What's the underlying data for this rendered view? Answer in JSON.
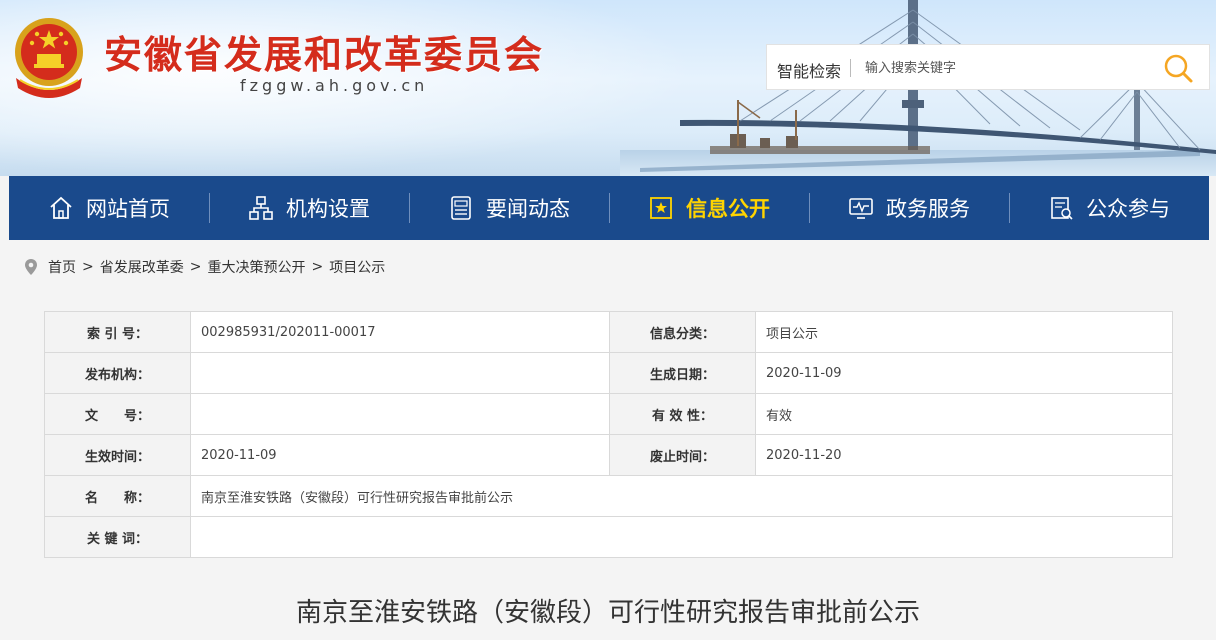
{
  "header": {
    "site_title": "安徽省发展和改革委员会",
    "site_domain": "fzggw.ah.gov.cn",
    "emblem_icon": "national-emblem-icon",
    "title_color": "#d42c1c"
  },
  "search": {
    "label": "智能检索",
    "placeholder": "输入搜索关键字",
    "icon": "search-icon",
    "icon_color": "#f5a623"
  },
  "nav": {
    "background": "#1a4a8c",
    "active_color": "#ffd400",
    "items": [
      {
        "label": "网站首页",
        "icon": "home-icon",
        "active": false
      },
      {
        "label": "机构设置",
        "icon": "org-chart-icon",
        "active": false
      },
      {
        "label": "要闻动态",
        "icon": "news-icon",
        "active": false
      },
      {
        "label": "信息公开",
        "icon": "document-star-icon",
        "active": true
      },
      {
        "label": "政务服务",
        "icon": "monitor-icon",
        "active": false
      },
      {
        "label": "公众参与",
        "icon": "participation-icon",
        "active": false
      }
    ]
  },
  "breadcrumb": {
    "icon": "location-pin-icon",
    "separator": ">",
    "items": [
      "首页",
      "省发展改革委",
      "重大决策预公开",
      "项目公示"
    ]
  },
  "info": {
    "index_label": "索 引 号：",
    "index_value": "002985931/202011-00017",
    "category_label": "信息分类：",
    "category_value": "项目公示",
    "publisher_label": "发布机构：",
    "publisher_value": "",
    "created_label": "生成日期：",
    "created_value": "2020-11-09",
    "docno_label": "文　　号：",
    "docno_value": "",
    "validity_label": "有 效 性：",
    "validity_value": "有效",
    "effective_label": "生效时间：",
    "effective_value": "2020-11-09",
    "expire_label": "废止时间：",
    "expire_value": "2020-11-20",
    "name_label": "名　　称：",
    "name_value": "南京至淮安铁路（安徽段）可行性研究报告审批前公示",
    "keywords_label": "关 键 词：",
    "keywords_value": ""
  },
  "article": {
    "title": "南京至淮安铁路（安徽段）可行性研究报告审批前公示"
  }
}
